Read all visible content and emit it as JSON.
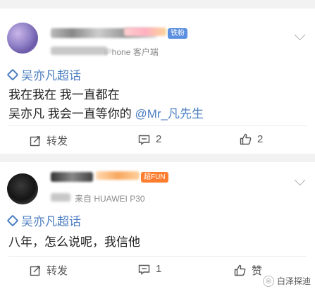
{
  "posts": [
    {
      "source_label": "iPhone 客户端",
      "badge": "铁粉",
      "topic": "吴亦凡超话",
      "lines": [
        "我在我在 我一直都在",
        "吴亦凡 我会一直等你的 "
      ],
      "mention": "@Mr_凡先生",
      "actions": {
        "repost": "转发",
        "comments": "2",
        "likes": "2"
      }
    },
    {
      "source_label": "来自 HUAWEI P30",
      "badge": "超FUN",
      "topic": "吴亦凡超话",
      "lines": [
        "八年，怎么说呢，我信他"
      ],
      "actions": {
        "repost": "转发",
        "comments": "1",
        "likes": "赞"
      }
    }
  ],
  "watermark": "白泽探迪"
}
